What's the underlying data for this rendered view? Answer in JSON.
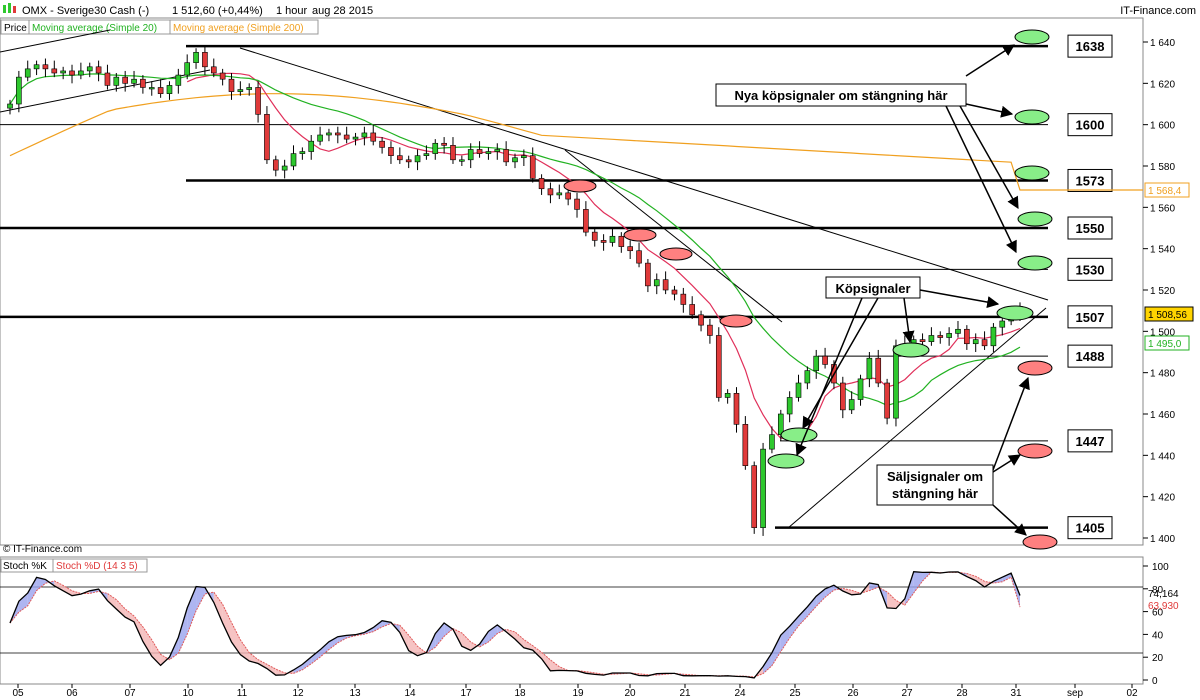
{
  "header": {
    "symbol": "OMX - Sverige30 Cash (-)",
    "quote": "1 512,60 (+0,44%)",
    "interval": "1 hour",
    "date": "aug 28 2015",
    "brand": "IT-Finance.com"
  },
  "legend": {
    "price": "Price",
    "ma20": "Moving average (Simple 20)",
    "ma200": "Moving average (Simple 200)"
  },
  "footer_copyright": "© IT-Finance.com",
  "stoch": {
    "label_k": "Stoch %K",
    "label_d": "Stoch %D (14 3 5)",
    "last_k": "74,164",
    "last_d": "63,930",
    "ticks": [
      "100",
      "80",
      "60",
      "40",
      "20",
      "0"
    ]
  },
  "price_axis": {
    "ticks": [
      "1 640",
      "1 620",
      "1 600",
      "1 580",
      "1 560",
      "1 540",
      "1 520",
      "1 500",
      "1 480",
      "1 460",
      "1 440",
      "1 420",
      "1 400"
    ],
    "last_price": "1 508,56",
    "ma200_value": "1 568,4",
    "ma20_value": "1 495,0"
  },
  "levels": [
    "1638",
    "1600",
    "1573",
    "1550",
    "1530",
    "1507",
    "1488",
    "1447",
    "1405"
  ],
  "annotations": {
    "buy_new": "Nya köpsignaler om stängning här",
    "buy": "Köpsignaler",
    "sell_line1": "Säljsignaler om",
    "sell_line2": "stängning här"
  },
  "x_axis": {
    "labels": [
      "05",
      "06",
      "07",
      "10",
      "11",
      "12",
      "13",
      "14",
      "17",
      "18",
      "19",
      "20",
      "21",
      "24",
      "25",
      "26",
      "27",
      "28",
      "31",
      "sep",
      "02"
    ]
  },
  "colors": {
    "ma20": "#22b222",
    "ma200": "#f0a020",
    "bull": "#2ec82e",
    "bear": "#e03a3a",
    "ma_red": "#e0305a",
    "buy_ellipse": "#88ee88",
    "sell_ellipse": "#ff8080"
  },
  "chart_data": {
    "type": "candlestick",
    "title": "OMX - Sverige30 Cash (-)",
    "interval": "1 hour",
    "ylim": [
      1397,
      1648
    ],
    "levels": [
      1638,
      1600,
      1573,
      1550,
      1530,
      1507,
      1488,
      1447,
      1405
    ],
    "candle_closes": [
      1610,
      1623,
      1627,
      1629,
      1627,
      1625,
      1626,
      1624,
      1626,
      1628,
      1625,
      1619,
      1623,
      1620,
      1622,
      1618,
      1618,
      1615,
      1619,
      1624,
      1630,
      1635,
      1628,
      1625,
      1622,
      1616,
      1617,
      1618,
      1605,
      1583,
      1578,
      1580,
      1586,
      1587,
      1592,
      1595,
      1596,
      1595,
      1593,
      1594,
      1596,
      1592,
      1589,
      1585,
      1583,
      1582,
      1585,
      1586,
      1591,
      1590,
      1583,
      1583,
      1588,
      1586,
      1587,
      1588,
      1582,
      1584,
      1585,
      1574,
      1569,
      1566,
      1567,
      1564,
      1559,
      1548,
      1544,
      1543,
      1546,
      1541,
      1539,
      1533,
      1522,
      1525,
      1520,
      1518,
      1513,
      1508,
      1503,
      1498,
      1468,
      1470,
      1455,
      1435,
      1405,
      1443,
      1450,
      1460,
      1468,
      1475,
      1481,
      1488,
      1484,
      1475,
      1462,
      1467,
      1477,
      1487,
      1475,
      1458,
      1493,
      1494,
      1496,
      1495,
      1498,
      1497,
      1499,
      1501,
      1494,
      1496,
      1493,
      1502,
      1505,
      1508,
      1512
    ],
    "ma20_last": 1495.0,
    "ma200_last": 1568.4,
    "stoch_k_last": 74.164,
    "stoch_d_last": 63.93,
    "stoch_ylim": [
      0,
      100
    ]
  }
}
